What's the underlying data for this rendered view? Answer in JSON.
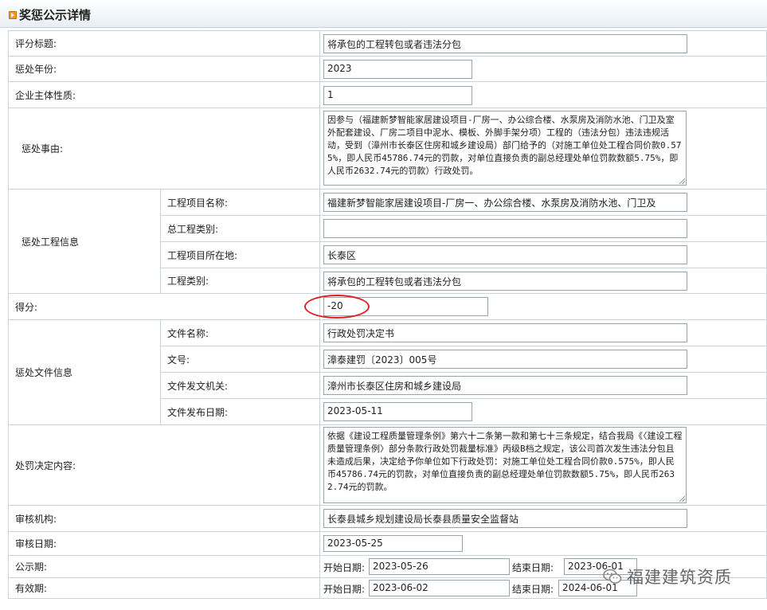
{
  "header": {
    "title": "奖惩公示详情"
  },
  "labels": {
    "title": "评分标题:",
    "year": "惩处年份:",
    "nature": "企业主体性质:",
    "reason": "惩处事由:",
    "project_info": "惩处工程信息",
    "project_name": "工程项目名称:",
    "main_type": "总工程类别:",
    "location": "工程项目所在地:",
    "type": "工程类别:",
    "score": "得分:",
    "doc_info": "惩处文件信息",
    "doc_name": "文件名称:",
    "doc_no": "文号:",
    "doc_org": "文件发文机关:",
    "doc_date": "文件发布日期:",
    "decision": "处罚决定内容:",
    "review_org": "审核机构:",
    "review_date": "审核日期:",
    "publicity": "公示期:",
    "validity": "有效期:",
    "start": "开始日期:",
    "end": "结束日期:"
  },
  "values": {
    "title": "将承包的工程转包或者违法分包",
    "year": "2023",
    "nature": "1",
    "reason": "因参与（福建新梦智能家居建设项目-厂房一、办公综合楼、水泵房及消防水池、门卫及室外配套建设、厂房二项目中泥水、模板、外脚手架分项）工程的（违法分包）违法违规活动，受到（漳州市长泰区住房和城乡建设局）部门给予的（对施工单位处工程合同价款0.575%，即人民币45786.74元的罚款，对单位直接负责的副总经理处单位罚款数额5.75%，即人民币2632.74元的罚款）行政处罚。",
    "project_name": "福建新梦智能家居建设项目-厂房一、办公综合楼、水泵房及消防水池、门卫及",
    "main_type": "",
    "location": "长泰区",
    "type": "将承包的工程转包或者违法分包",
    "score": "-20",
    "doc_name": "行政处罚决定书",
    "doc_no": "漳泰建罚〔2023〕005号",
    "doc_org": "漳州市长泰区住房和城乡建设局",
    "doc_date": "2023-05-11",
    "decision": "依据《建设工程质量管理条例》第六十二条第一款和第七十三条规定，结合我局《〈建设工程质量管理条例〉部分条款行政处罚裁量标准》丙级B档之规定，该公司首次发生违法分包且未造成后果，决定给予你单位如下行政处罚：对施工单位处工程合同价款0.575%，即人民币45786.74元的罚款，对单位直接负责的副总经理处单位罚款数额5.75%，即人民币2632.74元的罚款。",
    "review_org": "长泰县城乡规划建设局长泰县质量安全监督站",
    "review_date": "2023-05-25",
    "publicity_start": "2023-05-26",
    "publicity_end": "2023-06-01",
    "validity_start": "2023-06-02",
    "validity_end": "2024-06-01"
  },
  "watermark": {
    "text": "福建建筑资质",
    "icon": "wechat-logo-icon"
  }
}
